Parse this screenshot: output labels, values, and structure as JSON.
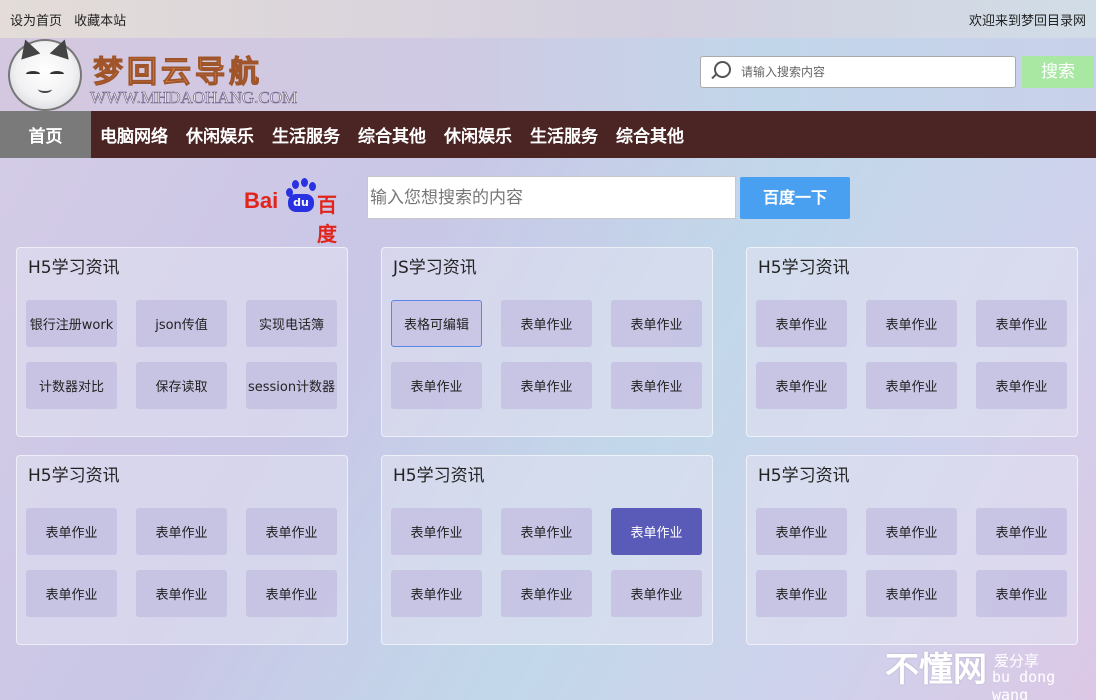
{
  "topbar": {
    "set_home": "设为首页",
    "bookmark": "收藏本站",
    "welcome": "欢迎来到梦回目录网"
  },
  "header": {
    "logo_title": "梦回云导航",
    "logo_subtitle": "WWW.MHDAOHANG.COM",
    "search_placeholder": "请输入搜索内容",
    "search_button": "搜索"
  },
  "nav": {
    "items": [
      "首页",
      "电脑网络",
      "休闲娱乐",
      "生活服务",
      "综合其他",
      "休闲娱乐",
      "生活服务",
      "综合其他"
    ]
  },
  "baidu": {
    "logo_text1": "Bai",
    "logo_du": "du",
    "logo_text2": "百度",
    "input_placeholder": "输入您想搜索的内容",
    "button": "百度一下"
  },
  "cards": [
    {
      "title": "H5学习资讯",
      "buttons": [
        "银行注册work",
        "json传值",
        "实现电话簿",
        "计数器对比",
        "保存读取",
        "session计数器"
      ]
    },
    {
      "title": "JS学习资讯",
      "buttons": [
        "表格可编辑",
        "表单作业",
        "表单作业",
        "表单作业",
        "表单作业",
        "表单作业"
      ]
    },
    {
      "title": "H5学习资讯",
      "buttons": [
        "表单作业",
        "表单作业",
        "表单作业",
        "表单作业",
        "表单作业",
        "表单作业"
      ]
    },
    {
      "title": "H5学习资讯",
      "buttons": [
        "表单作业",
        "表单作业",
        "表单作业",
        "表单作业",
        "表单作业",
        "表单作业"
      ]
    },
    {
      "title": "H5学习资讯",
      "buttons": [
        "表单作业",
        "表单作业",
        "表单作业",
        "表单作业",
        "表单作业",
        "表单作业"
      ]
    },
    {
      "title": "H5学习资讯",
      "buttons": [
        "表单作业",
        "表单作业",
        "表单作业",
        "表单作业",
        "表单作业",
        "表单作业"
      ]
    }
  ],
  "watermark": {
    "main": "不懂网",
    "sub1": "爱分享",
    "sub2": "bu dong wang"
  },
  "colors": {
    "nav_bg": "#4a2523",
    "nav_active": "#7a7a7a",
    "search_btn": "#a9e8a3",
    "baidu_btn": "#4aa0f0",
    "active_btn": "#5a5ab8",
    "outline_btn": "#5b86e5"
  }
}
